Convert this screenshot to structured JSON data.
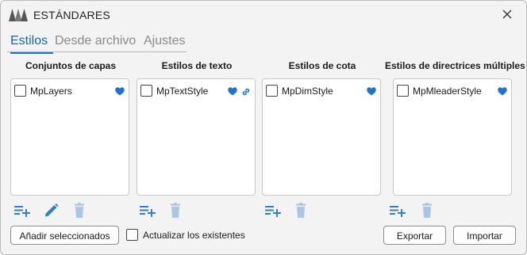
{
  "window": {
    "title": "ESTÁNDARES"
  },
  "icons": {
    "logo": "app-logo-icon",
    "close": "close-icon",
    "favorite": "heart-icon",
    "linked": "link-icon",
    "add": "add-list-icon",
    "edit": "pencil-icon",
    "delete": "trash-icon"
  },
  "colors": {
    "accent": "#1e73d2",
    "icon": "#2f7fd0",
    "icon_disabled": "#a9c6e6"
  },
  "tabs": [
    {
      "label": "Estilos",
      "active": true
    },
    {
      "label": "Desde archivo",
      "active": false
    },
    {
      "label": "Ajustes",
      "active": false
    }
  ],
  "columns": [
    {
      "title": "Conjuntos de capas",
      "item": "MpLayers",
      "checked": false,
      "favorite": true,
      "linked": false
    },
    {
      "title": "Estilos de texto",
      "item": "MpTextStyle",
      "checked": false,
      "favorite": true,
      "linked": true
    },
    {
      "title": "Estilos de cota",
      "item": "MpDimStyle",
      "checked": false,
      "favorite": true,
      "linked": false
    },
    {
      "title": "Estilos de directrices múltiples",
      "item": "MpMleaderStyle",
      "checked": false,
      "favorite": true,
      "linked": false
    }
  ],
  "footer": {
    "add_selected": "Añadir seleccionados",
    "update_existing": "Actualizar los existentes",
    "update_existing_checked": false,
    "export": "Exportar",
    "import": "Importar"
  }
}
